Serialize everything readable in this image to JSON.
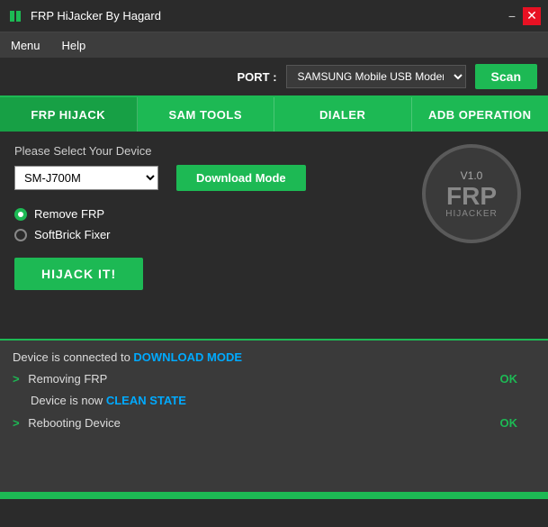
{
  "titleBar": {
    "title": "FRP HiJacker By Hagard",
    "minimizeLabel": "−",
    "closeLabel": "✕"
  },
  "menuBar": {
    "items": [
      {
        "label": "Menu"
      },
      {
        "label": "Help"
      }
    ]
  },
  "portBar": {
    "portLabel": "PORT :",
    "portValue": "SAMSUNG Mobile USB Modem #",
    "scanLabel": "Scan"
  },
  "tabs": [
    {
      "label": "FRP HIJACK",
      "active": true
    },
    {
      "label": "SAM TOOLS",
      "active": false
    },
    {
      "label": "DIALER",
      "active": false
    },
    {
      "label": "ADB OPERATION",
      "active": false
    }
  ],
  "mainContent": {
    "deviceSelectLabel": "Please Select Your Device",
    "deviceValue": "SM-J700M",
    "downloadModeLabel": "Download Mode",
    "frpBadge": {
      "version": "V1.0",
      "frp": "FRP",
      "hijacker": "HIJACKER"
    },
    "radioOptions": [
      {
        "label": "Remove FRP",
        "active": true
      },
      {
        "label": "SoftBrick Fixer",
        "active": false
      }
    ],
    "hijackLabel": "HIJACK IT!"
  },
  "logArea": {
    "lines": [
      {
        "type": "status",
        "text": "Device is connected to ",
        "highlight": "DOWNLOAD MODE"
      },
      {
        "type": "action",
        "arrow": ">",
        "text": "Removing FRP",
        "status": "OK"
      },
      {
        "type": "indent",
        "text": "Device is now ",
        "highlight": "CLEAN STATE"
      },
      {
        "type": "action",
        "arrow": ">",
        "text": "Rebooting Device",
        "status": "OK"
      }
    ]
  }
}
